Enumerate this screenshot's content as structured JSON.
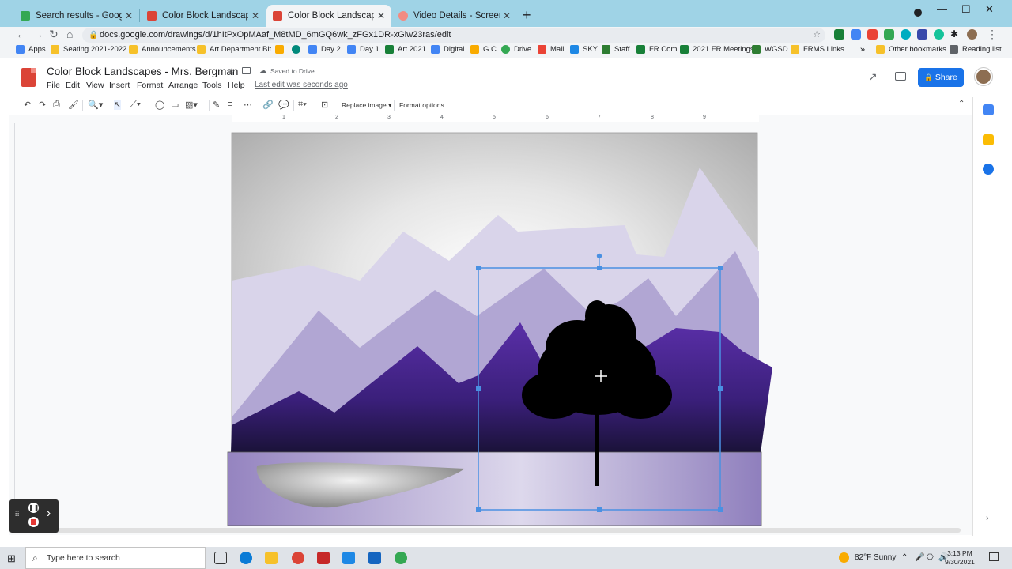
{
  "browser": {
    "tabs": [
      {
        "title": "Search results - Google Drive",
        "active": false,
        "favicon_color": "#34a853"
      },
      {
        "title": "Color Block Landscapes - Mrs. Be",
        "active": false,
        "favicon_color": "#db4437"
      },
      {
        "title": "Color Block Landscapes - Mrs. Be",
        "active": true,
        "favicon_color": "#db4437"
      },
      {
        "title": "Video Details - Screencastify",
        "active": false,
        "favicon_color": "#f28b82"
      }
    ],
    "url": "docs.google.com/drawings/d/1hItPxOpMAaf_M8tMD_6mGQ6wk_zFGx1DR-xGiw23ras/edit",
    "bookmarks": [
      {
        "label": "Apps",
        "icon": "apps-grid-icon"
      },
      {
        "label": "Seating 2021-2022...",
        "icon": "folder-icon"
      },
      {
        "label": "Announcements",
        "icon": "folder-icon"
      },
      {
        "label": "Art Department Bit...",
        "icon": "folder-icon"
      },
      {
        "label": "",
        "icon": "classroom-icon"
      },
      {
        "label": "",
        "icon": "google-meet-icon"
      },
      {
        "label": "Day 2",
        "icon": "docs-icon"
      },
      {
        "label": "Day 1",
        "icon": "docs-icon"
      },
      {
        "label": "Art 2021",
        "icon": "sheets-icon"
      },
      {
        "label": "Digital",
        "icon": "docs-icon"
      },
      {
        "label": "G.C",
        "icon": "classroom-icon"
      },
      {
        "label": "Drive",
        "icon": "drive-icon"
      },
      {
        "label": "Mail",
        "icon": "gmail-icon"
      },
      {
        "label": "SKY",
        "icon": "sky-icon"
      },
      {
        "label": "Staff",
        "icon": "staff-icon"
      },
      {
        "label": "FR Com",
        "icon": "sheets-icon"
      },
      {
        "label": "2021 FR Meetings",
        "icon": "sheets-icon"
      },
      {
        "label": "WGSD",
        "icon": "wgsd-icon"
      },
      {
        "label": "FRMS Links",
        "icon": "folder-icon"
      }
    ],
    "other_bookmarks": "Other bookmarks",
    "reading_list": "Reading list"
  },
  "app": {
    "title": "Color Block Landscapes - Mrs. Bergman",
    "saved_status": "Saved to Drive",
    "menu": [
      "File",
      "Edit",
      "View",
      "Insert",
      "Format",
      "Arrange",
      "Tools",
      "Help"
    ],
    "last_edit": "Last edit was seconds ago",
    "share_label": "Share",
    "toolbar": {
      "replace_image": "Replace image",
      "format_options": "Format options"
    },
    "ruler_marks": [
      "1",
      "2",
      "3",
      "4",
      "5",
      "6",
      "7",
      "8",
      "9"
    ]
  },
  "taskbar": {
    "search_placeholder": "Type here to search",
    "weather": "82°F  Sunny",
    "time": "3:13 PM",
    "date": "9/30/2021"
  },
  "colors": {
    "accent": "#1a73e8",
    "tab_strip": "#9fd3e6",
    "selection": "#4a90e2"
  }
}
